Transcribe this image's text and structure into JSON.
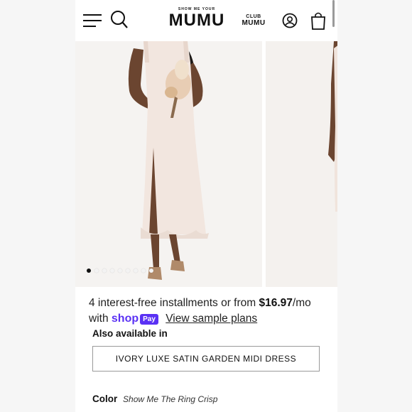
{
  "header": {
    "logo_top": "SHOW ME YOUR",
    "logo_main": "MUMU",
    "club_top": "CLUB",
    "club_main": "MUMU",
    "icons": [
      "hamburger-menu-icon",
      "search-icon",
      "account-icon",
      "shopping-bag-icon"
    ]
  },
  "gallery": {
    "slide_count": 9,
    "active_index": 0
  },
  "installments": {
    "prefix": "4 interest-free installments or from",
    "price": "$16.97",
    "suffix": "/mo",
    "with_text": "with",
    "shop_text": "shop",
    "pay_text": "Pay",
    "link_label": "View sample plans"
  },
  "also_available": {
    "heading": "Also available in",
    "option_label": "IVORY LUXE SATIN GARDEN MIDI DRESS"
  },
  "color": {
    "label": "Color",
    "value": "Show Me The Ring Crisp"
  },
  "colors": {
    "brand_shop_pay": "#5a31f4",
    "text": "#111111",
    "active_dot": "#111111"
  }
}
